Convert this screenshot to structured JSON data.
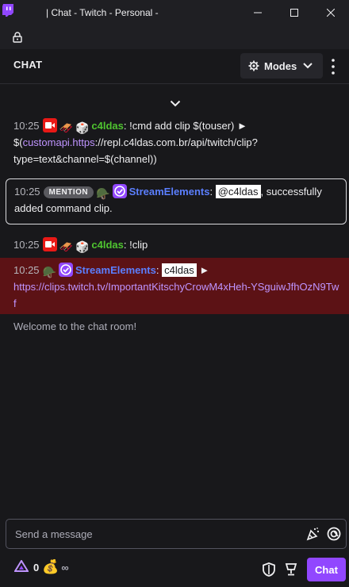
{
  "window": {
    "title": "| Chat - Twitch - Personal -"
  },
  "header": {
    "title": "CHAT",
    "modes_label": "Modes"
  },
  "messages": [
    {
      "time": "10:25",
      "user": "c4ldas",
      "text_pre": ": !cmd add clip $(touser) ► $(",
      "link1": "customapi.https",
      "text_post": "://repl.c4ldas.com.br/api/twitch/clip?type=text&channel=$(channel))"
    },
    {
      "time": "10:25",
      "tag": "MENTION",
      "user": "StreamElements",
      "colon": ":",
      "mention": "@c4ldas",
      "text": ", successfully added command clip."
    },
    {
      "time": "10:25",
      "user": "c4ldas",
      "text": ": !clip"
    },
    {
      "time": "10:25",
      "user": "StreamElements",
      "colon": ":",
      "mention": "c4ldas",
      "arrow": "►",
      "link": "https://clips.twitch.tv/ImportantKitschyCrowM4xHeh-YSguiwJfhOzN9Twf"
    }
  ],
  "welcome": "Welcome to the chat room!",
  "input": {
    "placeholder": "Send a message"
  },
  "footer": {
    "points": "0",
    "infinity": "∞",
    "chat_button": "Chat"
  },
  "colors": {
    "accent": "#9147ff",
    "username_green": "#4fc430",
    "username_blue": "#5b7fff",
    "highlight_row": "#5c1215"
  },
  "icons": [
    "twitch-logo-icon",
    "minimize-icon",
    "maximize-icon",
    "close-icon",
    "lock-icon",
    "gear-icon",
    "chevron-down-icon",
    "kebab-icon",
    "live-badge-icon",
    "verified-badge-icon",
    "emote-icon",
    "bits-icon",
    "channel-points-icon",
    "shield-icon",
    "cup-icon"
  ]
}
